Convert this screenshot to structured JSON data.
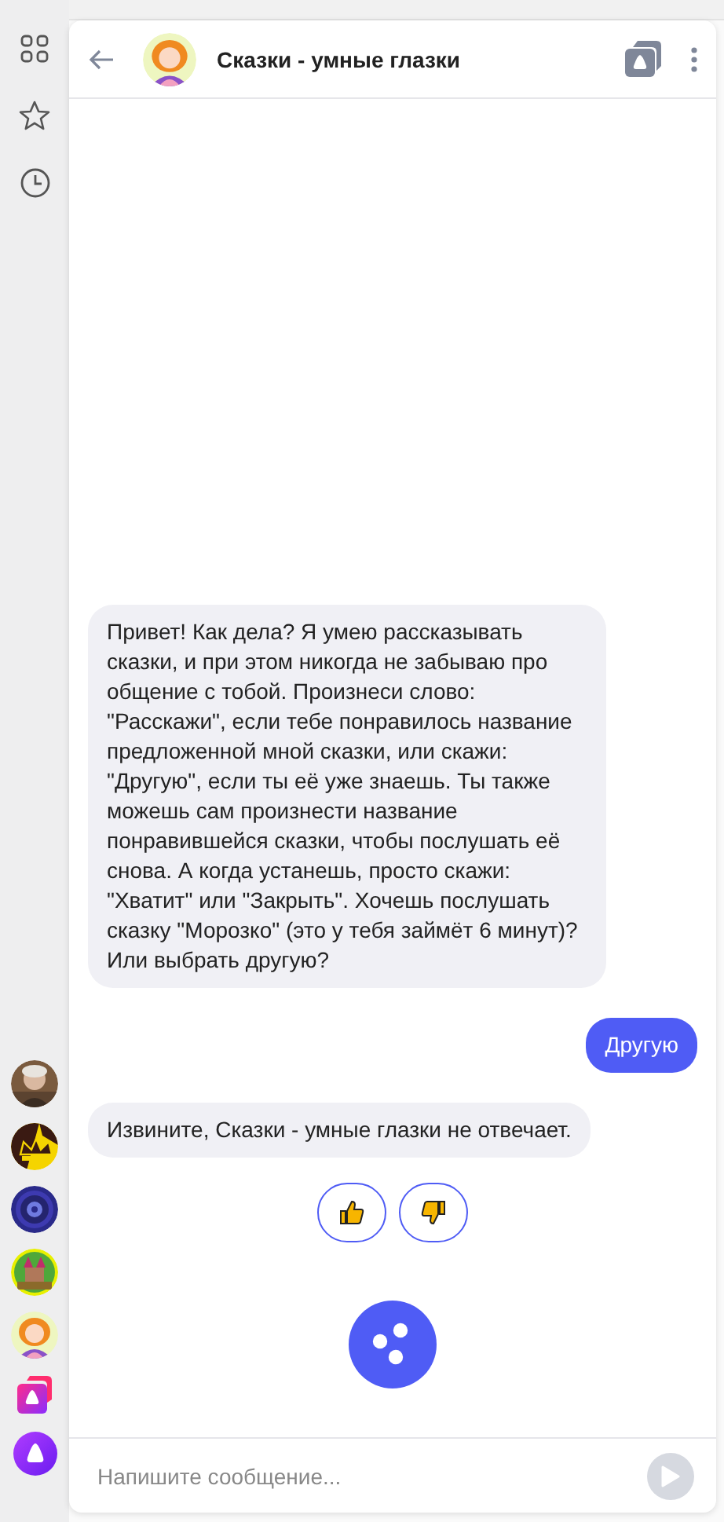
{
  "sidebar": {
    "nav": [
      {
        "kind": "grid"
      },
      {
        "kind": "star"
      },
      {
        "kind": "clock"
      }
    ],
    "skills": [
      {
        "kind": "picture"
      },
      {
        "kind": "picture"
      },
      {
        "kind": "picture"
      },
      {
        "kind": "picture"
      },
      {
        "kind": "picture"
      },
      {
        "kind": "cards"
      },
      {
        "kind": "assistant"
      }
    ]
  },
  "header": {
    "title": "Сказки - умные глазки"
  },
  "messages": [
    {
      "kind": "bot",
      "text": "Привет! Как дела? Я умею рассказывать сказки, и при этом никогда не забываю про общение с тобой. Произнеси слово: \"Расскажи\", если тебе понравилось название предложенной мной сказки, или скажи: \"Другую\", если ты её уже знаешь. Ты также можешь сам произнести название понравившейся сказки, чтобы послушать её снова. А когда устанешь, просто скажи: \"Хватит\" или \"Закрыть\". Хочешь послушать сказку \"Морозко\" (это у тебя займёт 6 минут)? Или выбрать другую?"
    },
    {
      "kind": "user",
      "text": "Другую"
    },
    {
      "kind": "bot",
      "text": "Извините, Сказки - умные глазки не отвечает."
    }
  ],
  "feedback": [
    {
      "kind": "like"
    },
    {
      "kind": "dislike"
    }
  ],
  "input": {
    "placeholder": "Напишите сообщение..."
  }
}
